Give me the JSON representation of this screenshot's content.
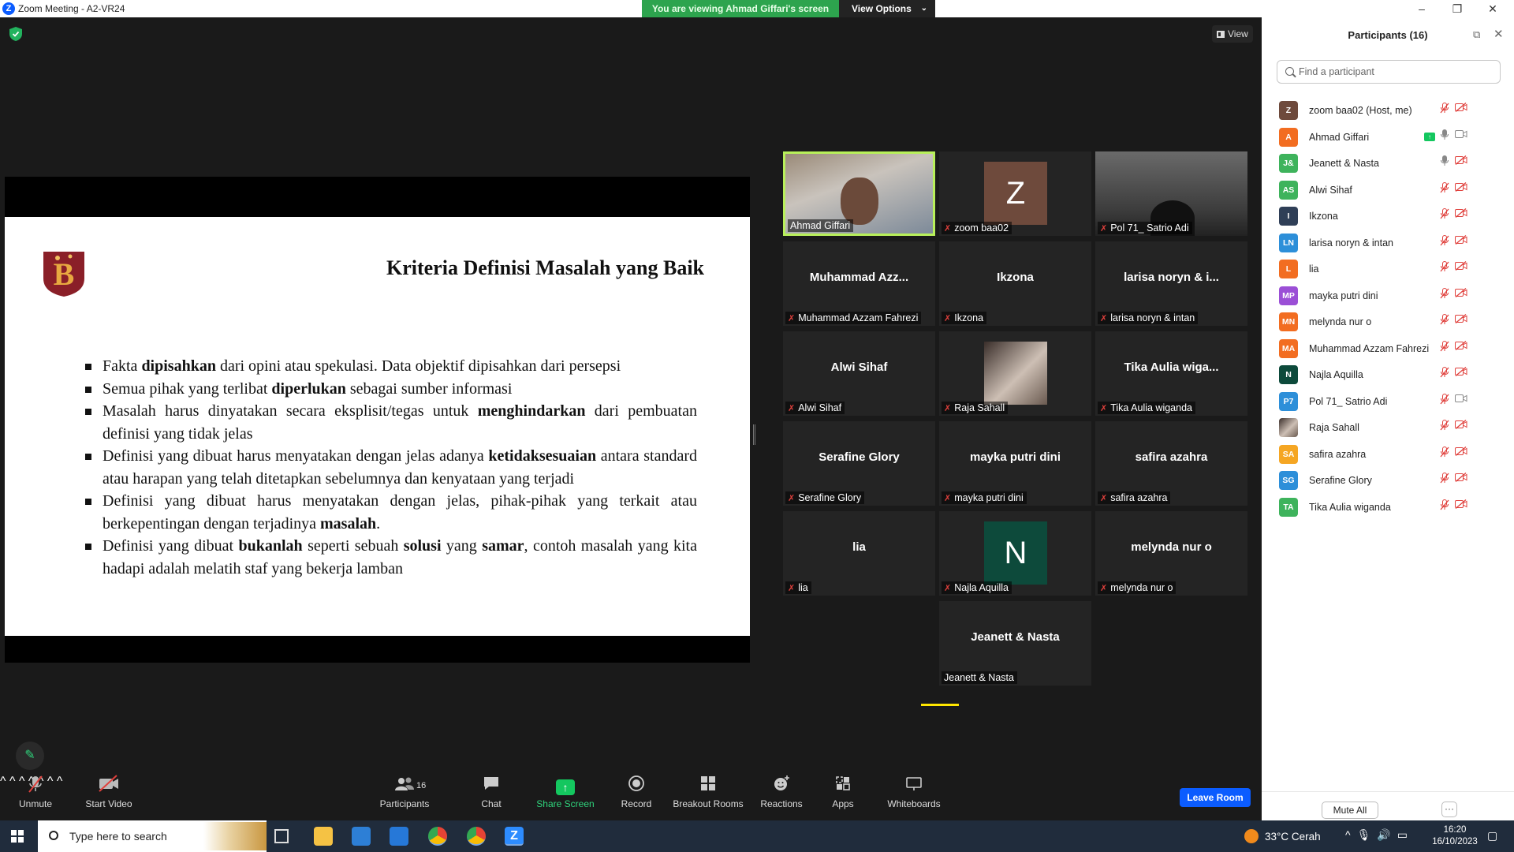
{
  "window": {
    "title": "Zoom Meeting - A2-VR24",
    "viewing_banner": "You are viewing Ahmad Giffari's screen",
    "view_options": "View Options",
    "view_button": "View"
  },
  "slide": {
    "title": "Kriteria Definisi Masalah yang Baik",
    "bullets": [
      [
        {
          "t": "Fakta "
        },
        {
          "t": "dipisahkan",
          "b": true
        },
        {
          "t": " dari opini atau spekulasi. Data objektif dipisahkan dari persepsi"
        }
      ],
      [
        {
          "t": "Semua pihak yang terlibat "
        },
        {
          "t": "diperlukan",
          "b": true
        },
        {
          "t": " sebagai sumber informasi"
        }
      ],
      [
        {
          "t": "Masalah harus dinyatakan secara eksplisit/tegas untuk "
        },
        {
          "t": "menghindarkan",
          "b": true
        },
        {
          "t": " dari pembuatan definisi yang tidak jelas"
        }
      ],
      [
        {
          "t": "Definisi yang dibuat harus menyatakan dengan jelas adanya "
        },
        {
          "t": "ketidaksesuaian",
          "b": true
        },
        {
          "t": " antara standard atau harapan yang telah ditetapkan sebelumnya dan kenyataan yang terjadi"
        }
      ],
      [
        {
          "t": "Definisi yang dibuat harus menyatakan dengan jelas, pihak-pihak yang terkait atau berkepentingan dengan terjadinya "
        },
        {
          "t": "masalah",
          "b": true
        },
        {
          "t": "."
        }
      ],
      [
        {
          "t": "Definisi yang dibuat "
        },
        {
          "t": "bukanlah",
          "b": true
        },
        {
          "t": " seperti sebuah "
        },
        {
          "t": "solusi",
          "b": true
        },
        {
          "t": " yang "
        },
        {
          "t": "samar",
          "b": true
        },
        {
          "t": ", contoh masalah yang kita hadapi adalah melatih staf  yang bekerja lamban"
        }
      ]
    ]
  },
  "gallery": [
    {
      "label": "Ahmad Giffari",
      "kind": "video-face",
      "muted": false,
      "active": true
    },
    {
      "label": "zoom baa02",
      "kind": "avatar",
      "avatar": "Z",
      "avatar_color": "#6e4a3c",
      "muted": true
    },
    {
      "label": "Pol 71_ Satrio Adi",
      "kind": "video-dark",
      "muted": true
    },
    {
      "label": "Muhammad Azzam Fahrezi",
      "center": "Muhammad  Azz...",
      "kind": "name",
      "muted": true
    },
    {
      "label": "Ikzona",
      "center": "Ikzona",
      "kind": "name",
      "muted": true
    },
    {
      "label": "larisa noryn & intan",
      "center": "larisa noryn & i...",
      "kind": "name",
      "muted": true
    },
    {
      "label": "Alwi Sihaf",
      "center": "Alwi Sihaf",
      "kind": "name",
      "muted": true
    },
    {
      "label": "Raja Sahall",
      "kind": "photo",
      "muted": true
    },
    {
      "label": "Tika Aulia wiganda",
      "center": "Tika  Aulia  wiga...",
      "kind": "name",
      "muted": true
    },
    {
      "label": "Serafine Glory",
      "center": "Serafine Glory",
      "kind": "name",
      "muted": true
    },
    {
      "label": "mayka putri dini",
      "center": "mayka putri dini",
      "kind": "name",
      "muted": true
    },
    {
      "label": "safira azahra",
      "center": "safira azahra",
      "kind": "name",
      "muted": true
    },
    {
      "label": "lia",
      "center": "lia",
      "kind": "name",
      "muted": true
    },
    {
      "label": "Najla Aquilla",
      "kind": "avatar",
      "avatar": "N",
      "avatar_color": "#0d4a3b",
      "muted": true
    },
    {
      "label": "melynda nur o",
      "center": "melynda nur o",
      "kind": "name",
      "muted": true
    },
    {
      "label": "Jeanett & Nasta",
      "center": "Jeanett & Nasta",
      "kind": "name",
      "muted": false
    }
  ],
  "toolbar": {
    "unmute": "Unmute",
    "start_video": "Start Video",
    "participants": "Participants",
    "participants_count": "16",
    "chat": "Chat",
    "share_screen": "Share Screen",
    "record": "Record",
    "breakout_rooms": "Breakout Rooms",
    "reactions": "Reactions",
    "apps": "Apps",
    "whiteboards": "Whiteboards",
    "leave_room": "Leave Room"
  },
  "panel": {
    "title": "Participants (16)",
    "search_placeholder": "Find a participant",
    "mute_all": "Mute All",
    "more": "···",
    "participants": [
      {
        "initials": "Z",
        "color": "#6e4a3c",
        "name": "zoom baa02 (Host, me)",
        "mic_on": false,
        "video_on": false,
        "sharing": false
      },
      {
        "initials": "A",
        "color": "#f26d21",
        "name": "Ahmad Giffari",
        "mic_on": true,
        "video_on": true,
        "sharing": true
      },
      {
        "initials": "J&",
        "color": "#3eb35c",
        "name": "Jeanett & Nasta",
        "mic_on": true,
        "video_on": false,
        "sharing": false
      },
      {
        "initials": "AS",
        "color": "#3eb35c",
        "name": "Alwi Sihaf",
        "mic_on": false,
        "video_on": false,
        "sharing": false
      },
      {
        "initials": "I",
        "color": "#2f3f57",
        "name": "Ikzona",
        "mic_on": false,
        "video_on": false,
        "sharing": false
      },
      {
        "initials": "LN",
        "color": "#2d8fd9",
        "name": "larisa noryn & intan",
        "mic_on": false,
        "video_on": false,
        "sharing": false
      },
      {
        "initials": "L",
        "color": "#f26d21",
        "name": "lia",
        "mic_on": false,
        "video_on": false,
        "sharing": false
      },
      {
        "initials": "MP",
        "color": "#9b4fd6",
        "name": "mayka putri dini",
        "mic_on": false,
        "video_on": false,
        "sharing": false
      },
      {
        "initials": "MN",
        "color": "#f26d21",
        "name": "melynda nur o",
        "mic_on": false,
        "video_on": false,
        "sharing": false
      },
      {
        "initials": "MA",
        "color": "#f26d21",
        "name": "Muhammad Azzam Fahrezi",
        "mic_on": false,
        "video_on": false,
        "sharing": false
      },
      {
        "initials": "N",
        "color": "#0d4a3b",
        "name": "Najla Aquilla",
        "mic_on": false,
        "video_on": false,
        "sharing": false
      },
      {
        "initials": "P7",
        "color": "#2d8fd9",
        "name": "Pol 71_ Satrio Adi",
        "mic_on": false,
        "video_on": true,
        "sharing": false
      },
      {
        "initials": "",
        "color": "#8a6a5a",
        "name": "Raja Sahall",
        "mic_on": false,
        "video_on": false,
        "sharing": false,
        "photo": true
      },
      {
        "initials": "SA",
        "color": "#f5a623",
        "name": "safira azahra",
        "mic_on": false,
        "video_on": false,
        "sharing": false
      },
      {
        "initials": "SG",
        "color": "#2d8fd9",
        "name": "Serafine Glory",
        "mic_on": false,
        "video_on": false,
        "sharing": false
      },
      {
        "initials": "TA",
        "color": "#3eb35c",
        "name": "Tika Aulia wiganda",
        "mic_on": false,
        "video_on": false,
        "sharing": false
      }
    ]
  },
  "taskbar": {
    "search_placeholder": "Type here to search",
    "weather": "33°C  Cerah",
    "time": "16:20",
    "date": "16/10/2023"
  }
}
